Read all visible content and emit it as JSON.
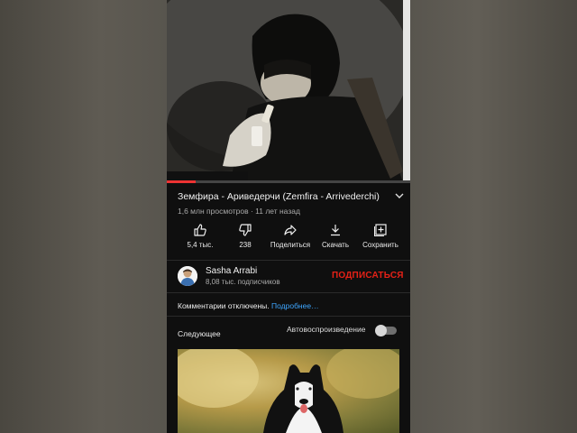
{
  "video": {
    "progress_fraction": 0.12,
    "title": "Земфира - Ариведерчи (Zemfira - Arrivederchi)",
    "meta": "1,6 млн просмотров · 11 лет назад"
  },
  "actions": [
    {
      "label": "5,4 тыс.",
      "icon": "like-icon"
    },
    {
      "label": "238",
      "icon": "dislike-icon"
    },
    {
      "label": "Поделиться",
      "icon": "share-icon"
    },
    {
      "label": "Скачать",
      "icon": "download-icon"
    },
    {
      "label": "Сохранить",
      "icon": "save-to-playlist-icon"
    }
  ],
  "channel": {
    "name": "Sasha Arrabi",
    "subscribers": "8,08 тыс. подписчиков",
    "subscribe_label": "ПОДПИСАТЬСЯ"
  },
  "comments": {
    "text": "Комментарии отключены.",
    "more": "Подробнее…"
  },
  "up_next": {
    "label": "Следующее",
    "autoplay_label": "Автовоспроизведение",
    "autoplay_on": false
  },
  "colors": {
    "accent_red": "#e62117",
    "link_blue": "#3ea6ff",
    "background": "#0f0f0f"
  }
}
